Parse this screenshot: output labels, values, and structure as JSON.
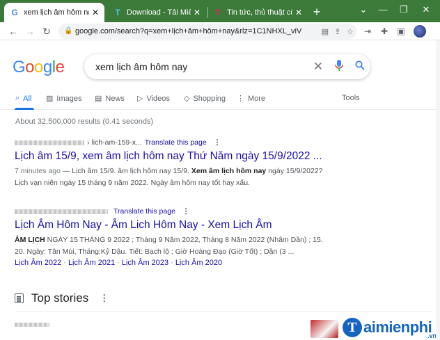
{
  "browser": {
    "tabs": [
      {
        "title": "xem lịch âm hôm nay - ",
        "favicon": "G"
      },
      {
        "title": "Download - Tải Miễn Phí",
        "favicon": "T"
      },
      {
        "title": "Tin tức, thủ thuật công ",
        "favicon": "T"
      }
    ],
    "new_tab": "+",
    "url": "google.com/search?q=xem+lịch+âm+hôm+nay&rlz=1C1NHXL_viV",
    "accent_color": "#3c7a3a"
  },
  "google": {
    "logo": {
      "G": "G",
      "o1": "o",
      "o2": "o",
      "g": "g",
      "l": "l",
      "e": "e"
    },
    "query": "xem lịch âm hôm nay",
    "tabs": [
      {
        "label": "All",
        "icon": "search-icon"
      },
      {
        "label": "Images",
        "icon": "image-icon"
      },
      {
        "label": "News",
        "icon": "news-icon"
      },
      {
        "label": "Videos",
        "icon": "video-icon"
      },
      {
        "label": "Shopping",
        "icon": "tag-icon"
      },
      {
        "label": "More",
        "icon": "more-vert-icon"
      }
    ],
    "tools": "Tools",
    "stats": "About 32,500,000 results (0.41 seconds)"
  },
  "results": [
    {
      "cite": "› lich-am-159-x...",
      "translate": "Translate this page",
      "title": "Lịch âm 15/9, xem âm lịch hôm nay Thứ Năm ngày 15/9/2022 ...",
      "date": "7 minutes ago",
      "snippet_pre": " — Lịch âm 15/9. âm lịch hôm nay 15/9. ",
      "snippet_bold": "Xem âm lịch hôm nay",
      "snippet_post": " ngày 15/9/2022?",
      "snippet_line2": "Lịch vạn niên ngày 15 tháng 9 năm 2022. Ngày âm hôm nay tốt hay xấu."
    },
    {
      "translate": "Translate this page",
      "title": "Lịch Âm Hôm Nay - Âm Lich Hôm Nay - Xem Lịch Âm",
      "snippet_bold": "ÂM LỊCH",
      "snippet_line1": " NGÀY 15 THÁNG 9 2022 ; Tháng 9 Năm 2022, Tháng 8 Năm 2022 (Nhâm Dần) ; 15.",
      "snippet_line2": "20. Ngày: Tân Mùi, Tháng:Kỷ Dậu. Tiết: Bạch lộ ; Giờ Hoàng Đạo (Giờ Tốt) ; Dần (3 ...",
      "sublinks": [
        "Lịch Âm 2022",
        "Lịch Âm 2021",
        "Lịch Âm 2023",
        "Lịch Âm 2020"
      ]
    }
  ],
  "top_stories": {
    "title": "Top stories"
  },
  "watermark": {
    "letter": "T",
    "text": "aimienphi",
    "suffix": ".vn"
  }
}
